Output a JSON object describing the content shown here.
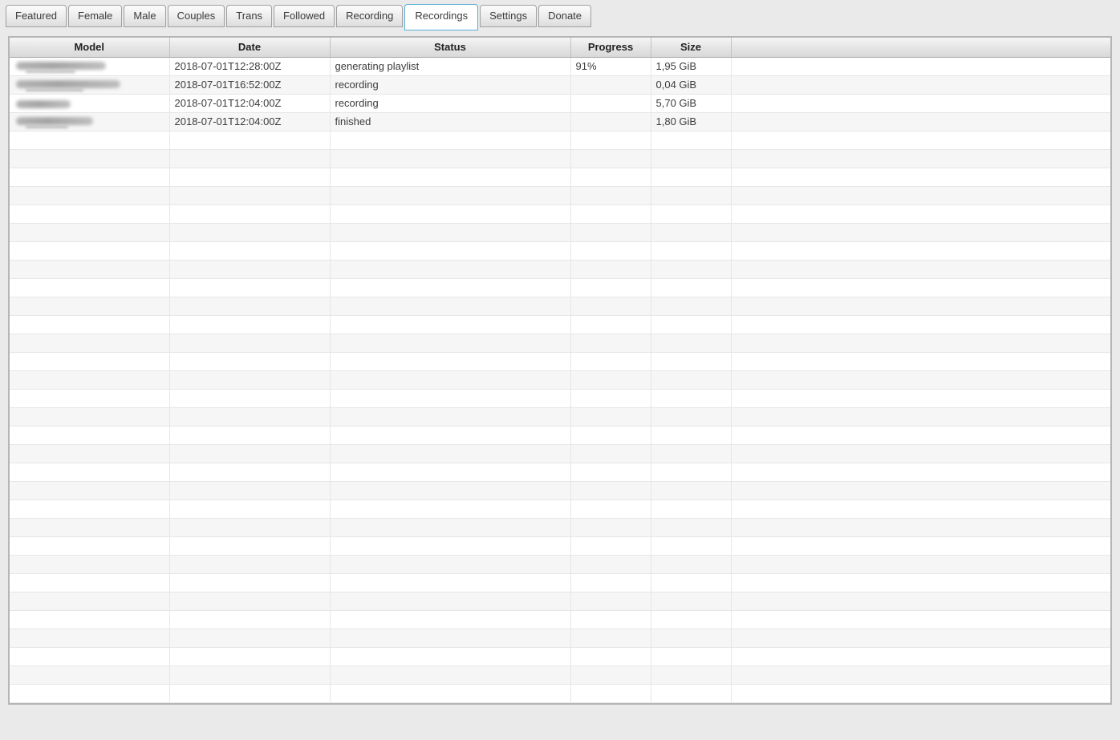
{
  "tabs": [
    {
      "label": "Featured",
      "active": false
    },
    {
      "label": "Female",
      "active": false
    },
    {
      "label": "Male",
      "active": false
    },
    {
      "label": "Couples",
      "active": false
    },
    {
      "label": "Trans",
      "active": false
    },
    {
      "label": "Followed",
      "active": false
    },
    {
      "label": "Recording",
      "active": false
    },
    {
      "label": "Recordings",
      "active": true
    },
    {
      "label": "Settings",
      "active": false
    },
    {
      "label": "Donate",
      "active": false
    }
  ],
  "table": {
    "columns": [
      "Model",
      "Date",
      "Status",
      "Progress",
      "Size",
      ""
    ],
    "rows": [
      {
        "model_redacted": true,
        "redaction_width": 112,
        "redaction_sub": true,
        "date": "2018-07-01T12:28:00Z",
        "status": "generating playlist",
        "progress": "91%",
        "size": "1,95 GiB"
      },
      {
        "model_redacted": true,
        "redaction_width": 130,
        "redaction_sub": true,
        "date": "2018-07-01T16:52:00Z",
        "status": "recording",
        "progress": "",
        "size": "0,04 GiB"
      },
      {
        "model_redacted": true,
        "redaction_width": 68,
        "redaction_sub": false,
        "date": "2018-07-01T12:04:00Z",
        "status": "recording",
        "progress": "",
        "size": "5,70 GiB"
      },
      {
        "model_redacted": true,
        "redaction_width": 96,
        "redaction_sub": true,
        "date": "2018-07-01T12:04:00Z",
        "status": "finished",
        "progress": "",
        "size": "1,80 GiB"
      }
    ],
    "empty_row_count": 31
  },
  "colors": {
    "page_background": "#eaeaea",
    "active_tab_border": "#58aed6",
    "table_border": "#b5b5b5",
    "header_gradient_top": "#f6f6f6",
    "header_gradient_bottom": "#d8d8d8",
    "row_alt_background": "#f6f6f6",
    "grid_line": "#e6e6e6",
    "redaction_blob": "#9e9e9e"
  }
}
